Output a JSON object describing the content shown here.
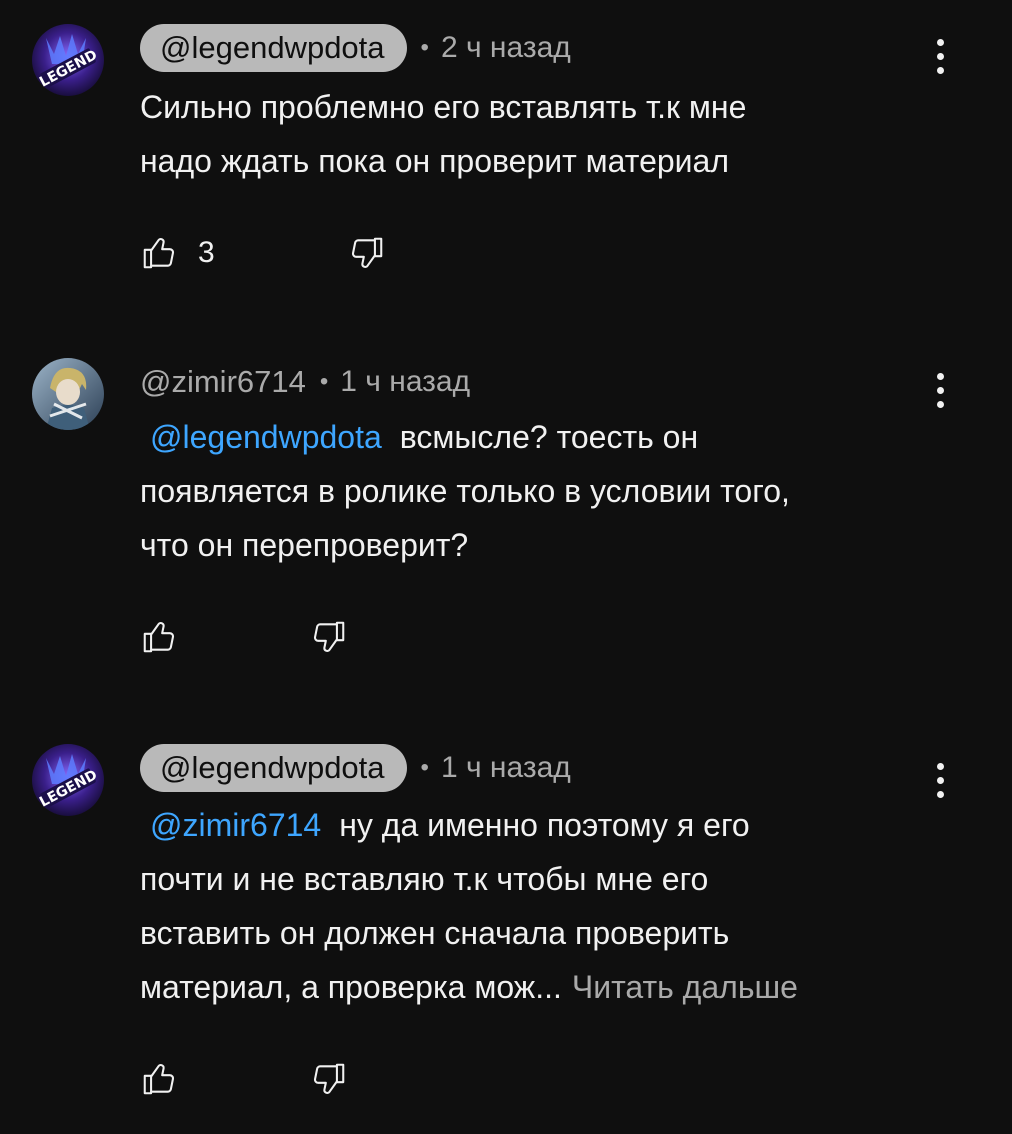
{
  "comments": [
    {
      "author": "@legendwpdota",
      "author_highlight": true,
      "avatar": "legend-logo-avatar",
      "dot": "•",
      "time": "2 ч назад",
      "mention": "",
      "lines": [
        "Сильно проблемно его вставлять т.к мне",
        "надо ждать пока он проверит материал"
      ],
      "likes": "3",
      "menu_icon": "more-vert-icon",
      "like_icon": "thumb-up-icon",
      "dislike_icon": "thumb-down-icon"
    },
    {
      "author": "@zimir6714",
      "author_highlight": false,
      "avatar": "anime-character-avatar",
      "dot": "•",
      "time": "1 ч назад",
      "mention": "@legendwpdota",
      "first_line_rest": "всмысле? тоесть он",
      "lines": [
        "появляется в ролике только в условии того,",
        "что он перепроверит?"
      ],
      "likes": "",
      "menu_icon": "more-vert-icon",
      "like_icon": "thumb-up-icon",
      "dislike_icon": "thumb-down-icon"
    },
    {
      "author": "@legendwpdota",
      "author_highlight": true,
      "avatar": "legend-logo-avatar",
      "dot": "•",
      "time": "1 ч назад",
      "mention": "@zimir6714",
      "first_line_rest": "ну да именно поэтому я его",
      "lines": [
        "почти и  не вставляю т.к чтобы мне его",
        "вставить он должен сначала проверить",
        "материал, а проверка мож..."
      ],
      "read_more": "Читать дальше",
      "likes": "",
      "menu_icon": "more-vert-icon",
      "like_icon": "thumb-up-icon",
      "dislike_icon": "thumb-down-icon"
    }
  ],
  "colors": {
    "background": "#0f0f0f",
    "text": "#f1f1f1",
    "secondary": "#aaaaaa",
    "mention": "#3ea6ff",
    "author_chip": "#b9b9b9"
  }
}
